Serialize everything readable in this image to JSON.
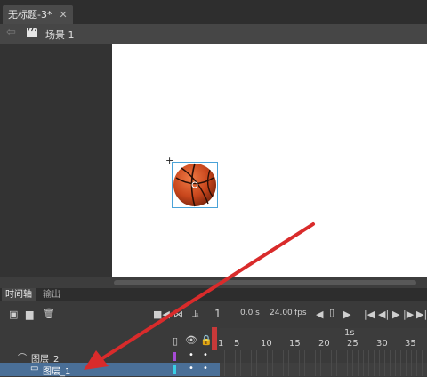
{
  "tabbar": {
    "doc_title": "无标题-3*",
    "close": "✕"
  },
  "scenebar": {
    "back": "⇦",
    "scene": "场景 1"
  },
  "timeline": {
    "tabs": [
      "时间轴",
      "输出"
    ],
    "time": "0.0 s",
    "fps_value": "24.00",
    "fps_unit": "fps",
    "current_frame": "1",
    "ruler_seconds": "1s",
    "ruler_ticks": [
      "1",
      "5",
      "10",
      "15",
      "20",
      "25",
      "30",
      "35"
    ],
    "layers": [
      {
        "name": "图层_2"
      },
      {
        "name": "图层_1",
        "selected": true
      }
    ]
  },
  "colors": {
    "accent": "#4a6f97",
    "arrow": "#d92b2b",
    "playhead": "#e03a3a"
  }
}
